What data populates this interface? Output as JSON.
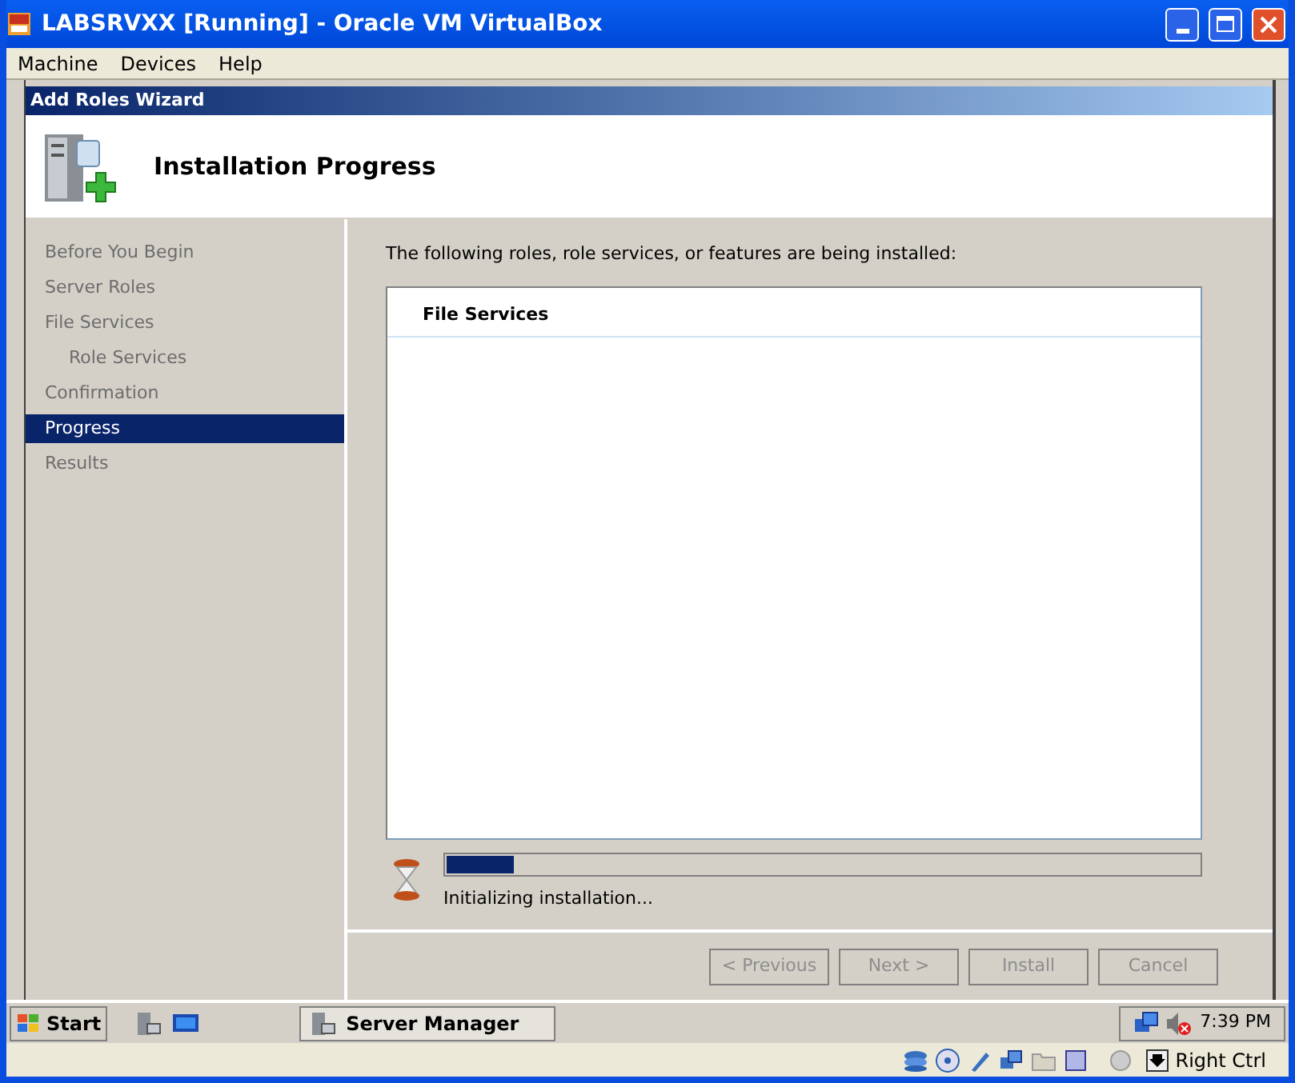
{
  "window": {
    "title": "LABSRVXX [Running] - Oracle VM VirtualBox"
  },
  "menu": [
    "Machine",
    "Devices",
    "Help"
  ],
  "wizard": {
    "title": "Add Roles Wizard",
    "heading": "Installation Progress",
    "steps": [
      {
        "label": "Before You Begin",
        "selected": false
      },
      {
        "label": "Server Roles",
        "selected": false
      },
      {
        "label": "File Services",
        "selected": false,
        "children": [
          {
            "label": "Role Services",
            "selected": false
          }
        ]
      },
      {
        "label": "Confirmation",
        "selected": false
      },
      {
        "label": "Progress",
        "selected": true
      },
      {
        "label": "Results",
        "selected": false
      }
    ],
    "intro": "The following roles, role services, or features are being installed:",
    "items": [
      "File Services"
    ],
    "progress": {
      "level": 0.09,
      "status": "Initializing installation..."
    },
    "buttons": [
      {
        "label": "< Previous",
        "disabled": true
      },
      {
        "label": "Next >",
        "disabled": true
      },
      {
        "label": "Install",
        "disabled": true
      },
      {
        "label": "Cancel",
        "disabled": true
      }
    ]
  },
  "taskbar": {
    "start": "Start",
    "task": "Server Manager",
    "clock": "7:39 PM"
  },
  "status_bar": {
    "host_key": "Right Ctrl"
  }
}
